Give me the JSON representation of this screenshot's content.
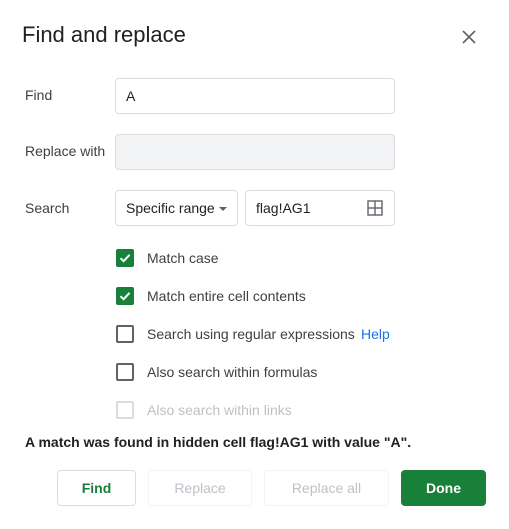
{
  "dialog": {
    "title": "Find and replace"
  },
  "fields": {
    "find_label": "Find",
    "find_value": "A",
    "replace_label": "Replace with",
    "replace_value": "",
    "search_label": "Search",
    "search_scope": "Specific range",
    "range_value": "flag!AG1"
  },
  "options": [
    {
      "label": "Match case",
      "checked": true,
      "disabled": false
    },
    {
      "label": "Match entire cell contents",
      "checked": true,
      "disabled": false
    },
    {
      "label": "Search using regular expressions",
      "checked": false,
      "disabled": false,
      "help": "Help"
    },
    {
      "label": "Also search within formulas",
      "checked": false,
      "disabled": false
    },
    {
      "label": "Also search within links",
      "checked": false,
      "disabled": true
    }
  ],
  "status": "A match was found in hidden cell flag!AG1 with value \"A\".",
  "buttons": {
    "find": "Find",
    "replace": "Replace",
    "replace_all": "Replace all",
    "done": "Done"
  },
  "colors": {
    "accent": "#188038",
    "link": "#1a73e8"
  },
  "icons": {
    "close": "close-icon",
    "dropdown": "chevron-down-icon",
    "range_picker": "grid-icon",
    "check": "check-icon"
  }
}
